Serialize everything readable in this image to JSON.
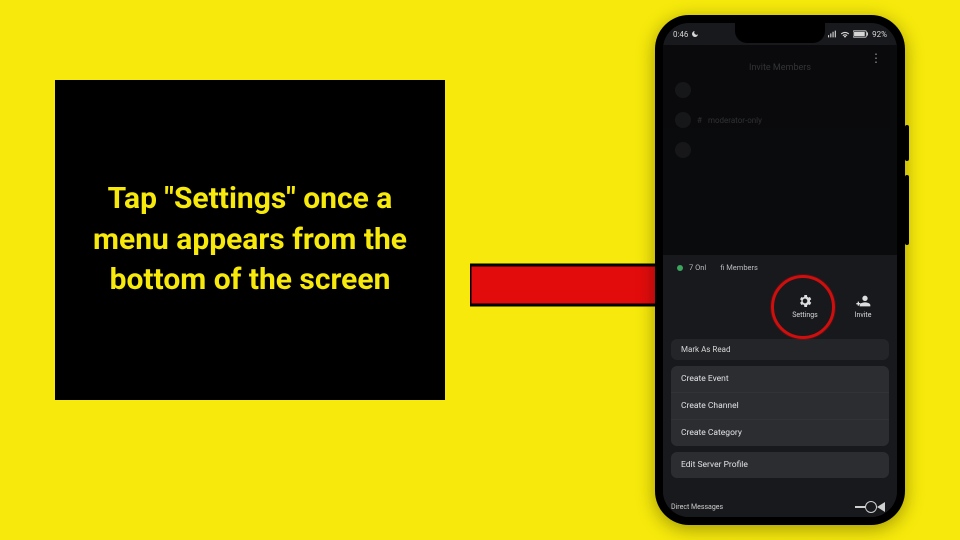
{
  "instruction": "Tap \"Settings\" once a menu appears from the bottom of the screen",
  "statusbar": {
    "time": "0:46",
    "batteryPct": "92%"
  },
  "dim": {
    "title": "Invite Members",
    "channel": "moderator-only"
  },
  "online": {
    "onlineText": "7 Onl",
    "membersText": "fi Members"
  },
  "pills": {
    "settings": "Settings",
    "invite": "Invite"
  },
  "readStrip": "Mark As Read",
  "menu1": {
    "a": "Create Event",
    "b": "Create Channel",
    "c": "Create Category"
  },
  "menu2": {
    "a": "Edit Server Profile"
  },
  "navLabel": "Direct Messages"
}
